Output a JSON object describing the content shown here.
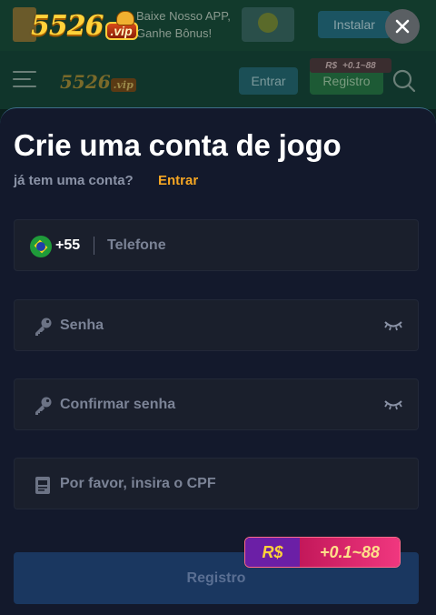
{
  "app_banner": {
    "text": "Baixe Nosso APP, Ganhe Bônus!",
    "install_label": "Instalar"
  },
  "brand": {
    "digits": "5526",
    "suffix": ".vip"
  },
  "nav": {
    "entrar_label": "Entrar",
    "registro_label": "Registro",
    "bonus_currency": "R$",
    "bonus_value": "+0.1~88"
  },
  "modal": {
    "title": "Crie uma conta de jogo",
    "subtitle": "já tem uma conta?",
    "login_link": "Entrar",
    "phone": {
      "code": "+55",
      "placeholder": "Telefone"
    },
    "password": {
      "placeholder": "Senha"
    },
    "confirm_password": {
      "placeholder": "Confirmar senha"
    },
    "cpf": {
      "placeholder": "Por favor, insira o CPF"
    },
    "submit_label": "Registro",
    "bonus_tag": {
      "currency": "R$",
      "value": "+0.1~88"
    }
  },
  "colors": {
    "accent_link": "#f5a623",
    "sheet_bg": "#13192c",
    "field_bg": "#1a1f2c",
    "submit_bg": "#1a3760"
  },
  "icons": {
    "close": "close-icon",
    "menu": "hamburger-menu-icon",
    "search": "search-icon",
    "key": "key-icon",
    "eye_closed": "eye-closed-icon",
    "cpf": "id-card-icon",
    "flag": "brazil-flag-icon"
  }
}
